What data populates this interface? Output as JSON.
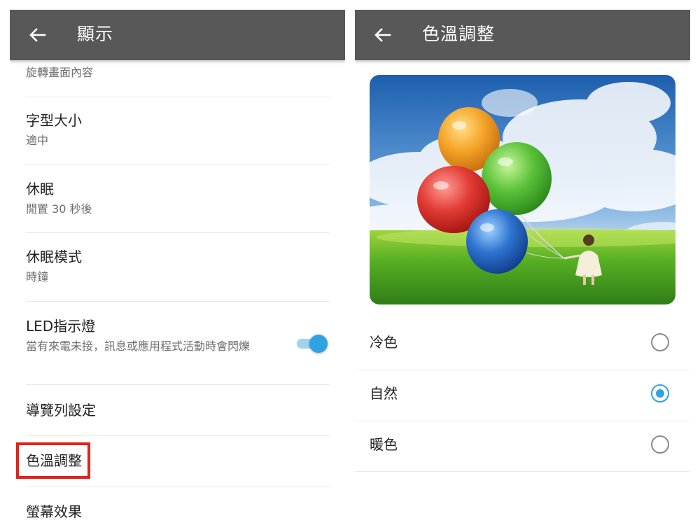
{
  "left_screen": {
    "appbar": {
      "title": "顯示",
      "back_icon": "arrow-left-icon"
    },
    "items": [
      {
        "title": "",
        "summary": "旋轉畫面內容"
      },
      {
        "title": "字型大小",
        "summary": "適中"
      },
      {
        "title": "休眠",
        "summary": "閒置 30 秒後"
      },
      {
        "title": "休眠模式",
        "summary": "時鐘"
      },
      {
        "title": "LED指示燈",
        "summary": "當有來電未接，訊息或應用程式活動時會閃爍",
        "toggle_on": true
      },
      {
        "title": "導覽列設定",
        "summary": ""
      },
      {
        "title": "色溫調整",
        "summary": "",
        "highlighted": true
      },
      {
        "title": "螢幕效果",
        "summary": ""
      }
    ]
  },
  "right_screen": {
    "appbar": {
      "title": "色溫調整",
      "back_icon": "arrow-left-icon"
    },
    "preview_image": "balloons-field-image",
    "options": [
      {
        "label": "冷色",
        "selected": false
      },
      {
        "label": "自然",
        "selected": true
      },
      {
        "label": "暖色",
        "selected": false
      }
    ]
  },
  "colors": {
    "appbar": "#585858",
    "accent": "#2fa3e1",
    "highlight": "#e3231b"
  }
}
